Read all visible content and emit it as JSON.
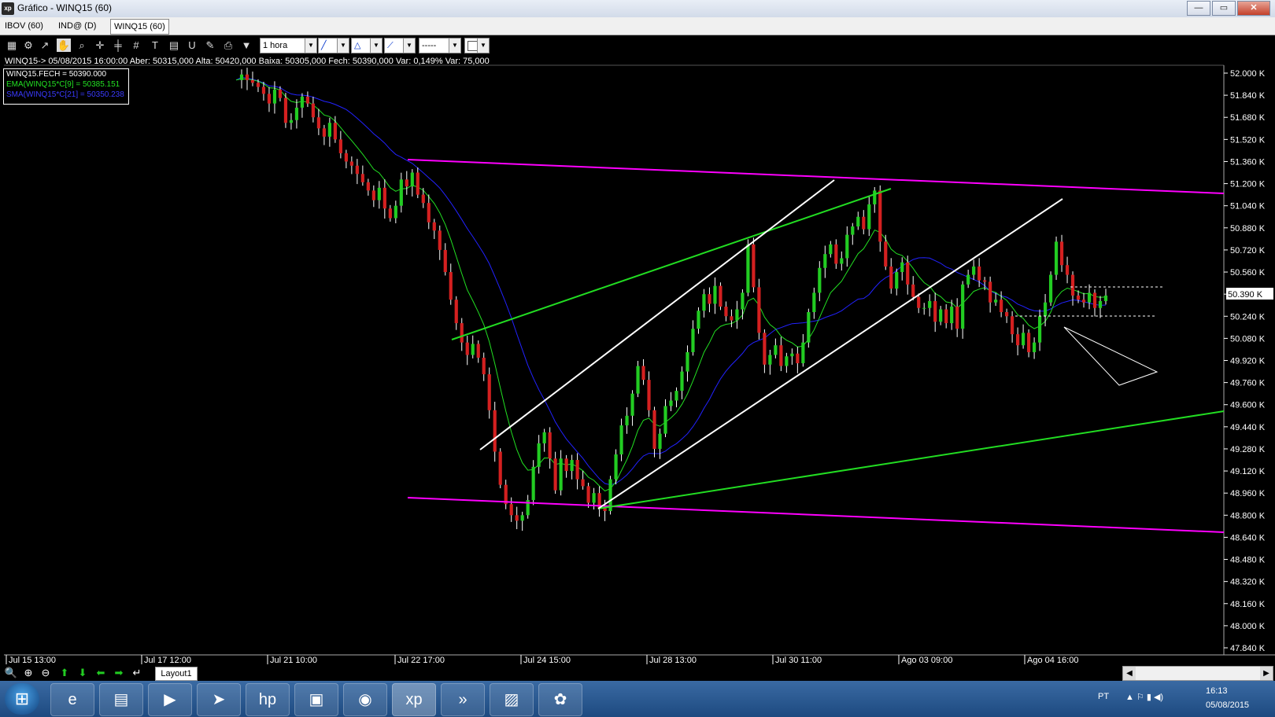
{
  "window": {
    "title": "Gráfico - WINQ15 (60)",
    "app_icon": "xp"
  },
  "tabs": [
    {
      "label": "IBOV (60)",
      "active": false
    },
    {
      "label": "IND@ (D)",
      "active": false
    },
    {
      "label": "WINQ15 (60)",
      "active": true
    }
  ],
  "toolbar": {
    "timeframe": "1 hora"
  },
  "info_line": "WINQ15-> 05/08/2015 16:00:00 Aber: 50315,000 Alta: 50420,000 Baixa: 50305,000 Fech: 50390,000 Var: 0,149% Var: 75,000",
  "legend": [
    {
      "text": "WINQ15.FECH = 50390.000",
      "color": "#ffffff"
    },
    {
      "text": "EMA(WINQ15*C[9] = 50385.151",
      "color": "#22e022"
    },
    {
      "text": "SMA(WINQ15*C[21] = 50350.238",
      "color": "#3a3aff"
    }
  ],
  "bottom": {
    "layout_tab": "Layout1"
  },
  "taskbar": {
    "lang": "PT",
    "time": "16:13",
    "date": "05/08/2015"
  },
  "chart_data": {
    "type": "candlestick",
    "symbol": "WINQ15",
    "y_ticks": [
      "52.000 K",
      "51.840 K",
      "51.680 K",
      "51.520 K",
      "51.360 K",
      "51.200 K",
      "51.040 K",
      "50.880 K",
      "50.720 K",
      "50.560 K",
      "50.400 K",
      "50.240 K",
      "50.080 K",
      "49.920 K",
      "49.760 K",
      "49.600 K",
      "49.440 K",
      "49.280 K",
      "49.120 K",
      "48.960 K",
      "48.800 K",
      "48.640 K",
      "48.480 K",
      "48.320 K",
      "48.160 K",
      "48.000 K",
      "47.840 K"
    ],
    "ylim": [
      47840,
      52000
    ],
    "x_ticks": [
      "Jul 15 13:00",
      "Jul 17 12:00",
      "Jul 21 10:00",
      "Jul 22 17:00",
      "Jul 24 15:00",
      "Jul 28 13:00",
      "Jul 30 11:00",
      "Ago 03 09:00",
      "Ago 04 16:00"
    ],
    "last_price_label": "50.390 K",
    "colors": {
      "up": "#22cc22",
      "down": "#d42020",
      "ema": "#22e022",
      "sma": "#2222ff",
      "trend_magenta": "#ff00ff",
      "trend_green": "#22dd22",
      "trend_white": "#ffffff"
    },
    "closes": [
      51950,
      51990,
      51950,
      51930,
      51900,
      51850,
      51780,
      51880,
      51820,
      51640,
      51660,
      51750,
      51830,
      51780,
      51680,
      51600,
      51540,
      51640,
      51520,
      51420,
      51360,
      51330,
      51270,
      51210,
      51150,
      51080,
      51170,
      51020,
      50950,
      51040,
      51230,
      51180,
      51280,
      51120,
      51060,
      50920,
      50860,
      50720,
      50560,
      50360,
      50190,
      50050,
      49960,
      50040,
      49940,
      49820,
      49560,
      49260,
      49020,
      48880,
      48800,
      48760,
      48800,
      48910,
      49150,
      49320,
      49400,
      49210,
      48980,
      49210,
      49120,
      49200,
      49060,
      49010,
      48890,
      48960,
      48850,
      48830,
      49060,
      49240,
      49450,
      49520,
      49680,
      49880,
      49780,
      49560,
      49280,
      49390,
      49590,
      49630,
      49700,
      49840,
      49980,
      50150,
      50280,
      50400,
      50330,
      50460,
      50310,
      50240,
      50210,
      50290,
      50410,
      50760,
      50450,
      50120,
      49890,
      49960,
      50030,
      49880,
      49950,
      49970,
      49900,
      50050,
      50270,
      50410,
      50590,
      50690,
      50760,
      50620,
      50660,
      50830,
      50890,
      50960,
      50870,
      51050,
      51150,
      50780,
      50600,
      50440,
      50560,
      50630,
      50470,
      50380,
      50300,
      50300,
      50350,
      50200,
      50290,
      50190,
      50310,
      50150,
      50470,
      50540,
      50600,
      50500,
      50490,
      50340,
      50360,
      50270,
      50240,
      50110,
      50030,
      50120,
      49980,
      50050,
      50240,
      50340,
      50540,
      50780,
      50610,
      50540,
      50390,
      50360,
      50340,
      50410,
      50300,
      50350,
      50390
    ]
  }
}
